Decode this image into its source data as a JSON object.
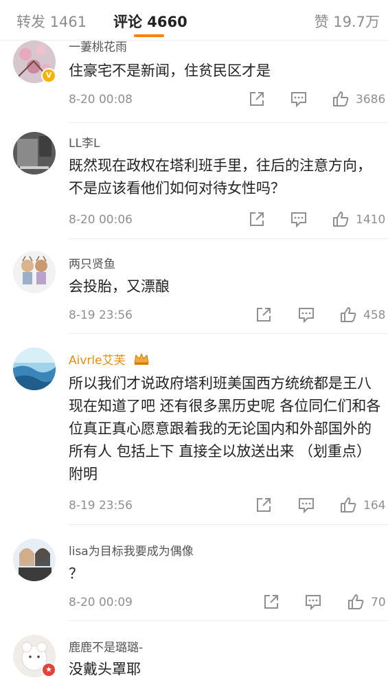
{
  "tabs": {
    "reposts": "转发 1461",
    "comments": "评论 4660",
    "likes": "赞 19.7万"
  },
  "colors": {
    "accent": "#ff8200",
    "vip_name": "#e78c0b",
    "badge_verified": "#f5b400",
    "badge_red": "#e5433a"
  },
  "comments": [
    {
      "user": "一萋桃花雨",
      "text": "住豪宅不是新闻，住贫民区才是",
      "time": "8-20 00:08",
      "likes": "3686",
      "badge": "v"
    },
    {
      "user": "LL李L",
      "text": "既然现在政权在塔利班手里，往后的注意方向，不是应该看他们如何对待女性吗？",
      "time": "8-20 00:06",
      "likes": "1410"
    },
    {
      "user": "两只贤鱼",
      "text": "会投胎，又漂酿",
      "time": "8-19 23:56",
      "likes": "458"
    },
    {
      "user": "Aivrle艾芙",
      "text": "所以我们才说政府塔利班美国西方统统都是王八 现在知道了吧 还有很多黑历史呢 各位同仁们和各位真正真心愿意跟着我的无论国内和外部国外的所有人 包括上下 直接全以放送出来 （划重点）附明",
      "time": "8-19 23:56",
      "likes": "164"
    },
    {
      "user": "lisa为目标我要成为偶像",
      "text": "？",
      "time": "8-20 00:09",
      "likes": "70"
    },
    {
      "user": "鹿鹿不是璐璐-",
      "text": "没戴头罩耶",
      "badge": "red"
    }
  ],
  "icons": [
    "repost-icon",
    "reply-icon",
    "like-icon",
    "verified-badge-icon",
    "crown-icon"
  ]
}
